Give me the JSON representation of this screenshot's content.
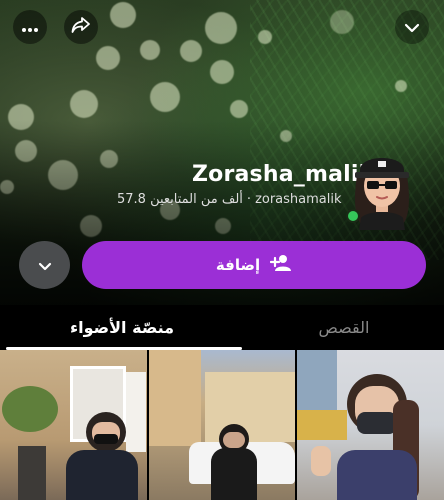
{
  "profile": {
    "display_name": "Zorasha_malik",
    "username": "zorashamalik",
    "separator": "·",
    "followers": "57.8 ألف من المتابعين"
  },
  "actions": {
    "add_label": "إضافة"
  },
  "tabs": {
    "spotlight_label": "منصّة الأضواء",
    "stories_label": "القصص"
  },
  "colors": {
    "accent": "#9b2fd6",
    "online": "#35c65a",
    "tab_inactive": "#8a8a8a"
  },
  "icons": {
    "more": "more-horizontal-icon",
    "share": "share-arrow-icon",
    "collapse": "chevron-down-icon",
    "menu": "chevron-down-icon",
    "add_friend": "add-friend-icon"
  }
}
